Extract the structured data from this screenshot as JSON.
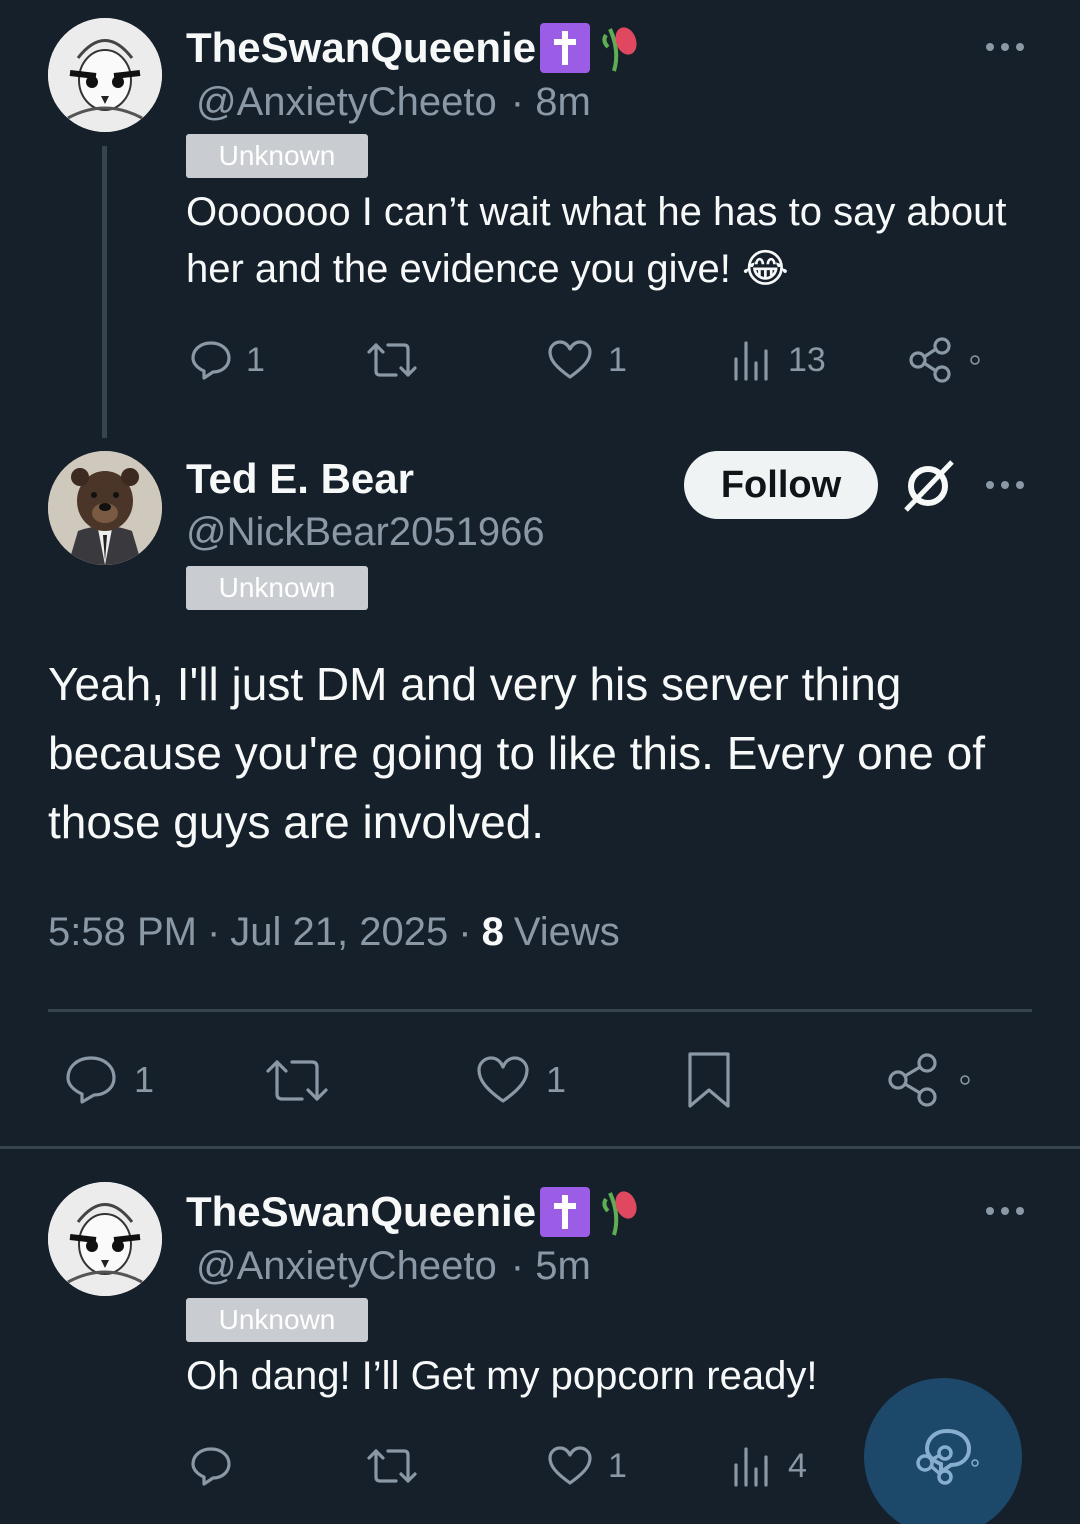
{
  "reply1": {
    "name": "TheSwanQueenie",
    "name_emojis": [
      "cross-icon",
      "wilted-rose-icon"
    ],
    "handle": "@AnxietyCheeto",
    "time": "· 8m",
    "badge": "Unknown",
    "text": "Ooooooo I can’t wait what he has to say about her and the evidence you give! 😂",
    "replies": "1",
    "likes": "1",
    "views": "13"
  },
  "main": {
    "name": "Ted E. Bear",
    "handle": "@NickBear2051966",
    "badge": "Unknown",
    "follow_label": "Follow",
    "text": "Yeah, I'll just DM and very his server thing because you're going to like this. Every one of those guys are involved.",
    "time": "5:58 PM",
    "date": "Jul 21, 2025",
    "views_count": "8",
    "views_label": "Views",
    "replies": "1",
    "likes": "1"
  },
  "reply2": {
    "name": "TheSwanQueenie",
    "name_emojis": [
      "cross-icon",
      "wilted-rose-icon"
    ],
    "handle": "@AnxietyCheeto",
    "time": "· 5m",
    "badge": "Unknown",
    "text": "Oh dang! I’ll Get my popcorn ready!",
    "likes": "1",
    "views": "4"
  },
  "colors": {
    "background": "#15202b",
    "text_primary": "#f7f9f9",
    "text_secondary": "#8b98a5",
    "divider": "#38444d",
    "badge": "#c9cdd1",
    "accent_purple": "#9b5de5",
    "fab": "#1d4b6e"
  }
}
